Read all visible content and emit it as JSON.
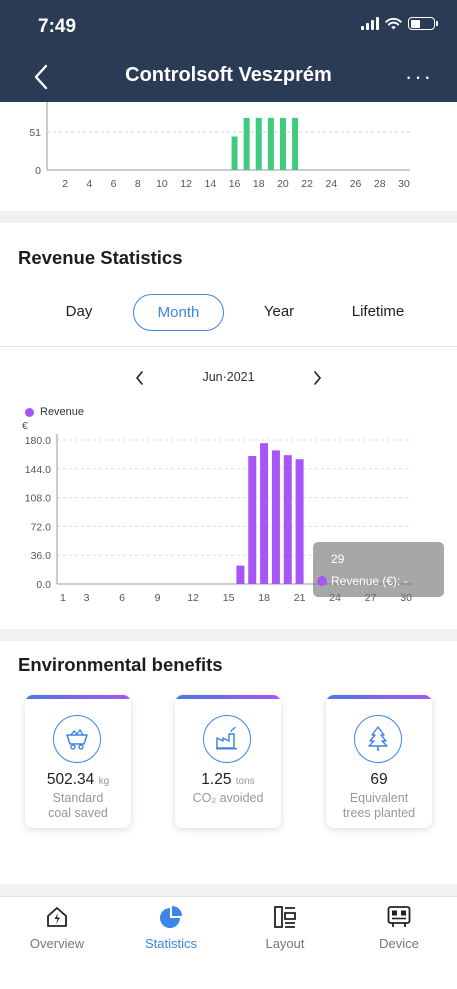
{
  "status_bar": {
    "time": "7:49"
  },
  "nav": {
    "title": "Controlsoft Veszprém",
    "back_icon": "chevron-left-icon",
    "more_icon": "ellipsis-icon"
  },
  "energy_chart": {
    "chart_data": {
      "type": "bar",
      "y_tick_labels": [
        "0",
        "51"
      ],
      "x_tick_labels": [
        "2",
        "4",
        "6",
        "8",
        "10",
        "12",
        "14",
        "16",
        "18",
        "20",
        "22",
        "24",
        "26",
        "28",
        "30"
      ],
      "x": [
        16,
        17,
        18,
        19,
        20,
        21
      ],
      "values": [
        45,
        70,
        70,
        70,
        70,
        70
      ],
      "bar_color": "#3ecb7d"
    }
  },
  "revenue": {
    "title": "Revenue Statistics",
    "tabs": [
      {
        "label": "Day",
        "active": false
      },
      {
        "label": "Month",
        "active": true
      },
      {
        "label": "Year",
        "active": false
      },
      {
        "label": "Lifetime",
        "active": false
      }
    ],
    "month_label": "Jun·2021",
    "legend_label": "Revenue",
    "currency_label": "€",
    "chart_data": {
      "type": "bar",
      "series": [
        {
          "name": "Revenue",
          "color": "#a855f7"
        }
      ],
      "y_tick_labels": [
        "0.0",
        "36.0",
        "72.0",
        "108.0",
        "144.0",
        "180.0"
      ],
      "ylim": [
        0,
        180
      ],
      "x_tick_labels": [
        "1",
        "3",
        "6",
        "9",
        "12",
        "15",
        "18",
        "21",
        "24",
        "27",
        "30"
      ],
      "x": [
        16,
        17,
        18,
        19,
        20,
        21
      ],
      "values": [
        23,
        160,
        176,
        167,
        161,
        156
      ]
    },
    "tooltip": {
      "day": "29",
      "text": "Revenue (€): -"
    }
  },
  "environment": {
    "title": "Environmental benefits",
    "items": [
      {
        "icon": "coal-cart-icon",
        "value": "502.34",
        "unit": "kg",
        "label_line1": "Standard",
        "label_line2": "coal saved"
      },
      {
        "icon": "factory-icon",
        "value": "1.25",
        "unit": "tons",
        "label_line1": "CO₂ avoided",
        "label_line2": ""
      },
      {
        "icon": "tree-icon",
        "value": "69",
        "unit": "",
        "label_line1": "Equivalent",
        "label_line2": "trees planted"
      }
    ]
  },
  "tabbar": {
    "items": [
      {
        "label": "Overview",
        "icon": "lightning-house-icon",
        "active": false
      },
      {
        "label": "Statistics",
        "icon": "pie-chart-icon",
        "active": true
      },
      {
        "label": "Layout",
        "icon": "layout-icon",
        "active": false
      },
      {
        "label": "Device",
        "icon": "device-icon",
        "active": false
      }
    ]
  },
  "colors": {
    "header": "#2b3b55",
    "accent": "#3c86e6",
    "revenue": "#a855f7",
    "energy": "#3ecb7d"
  }
}
